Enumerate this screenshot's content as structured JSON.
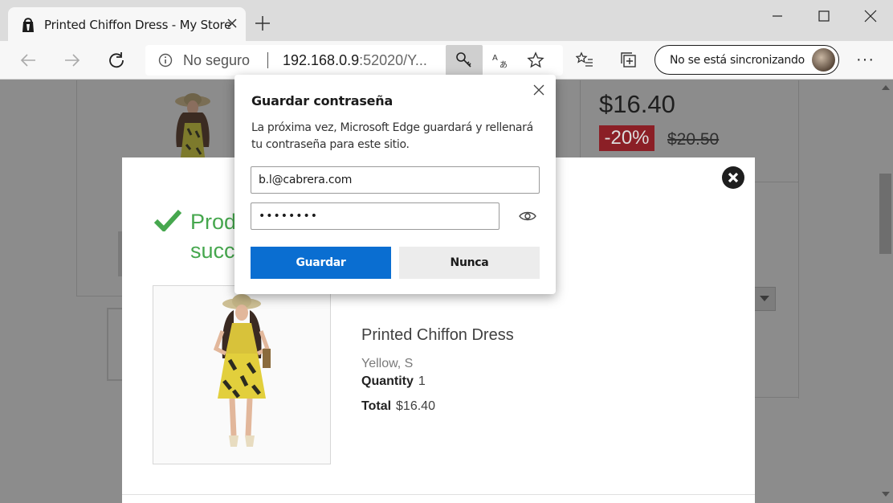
{
  "browser": {
    "tab_title": "Printed Chiffon Dress - My Store",
    "not_secure_label": "No seguro",
    "url_host": "192.168.0.9",
    "url_rest": ":52020/Y...",
    "sync_label": "No se está sincronizando",
    "more_label": "···"
  },
  "page": {
    "price": "$16.40",
    "discount": "-20%",
    "old_price": "$20.50"
  },
  "cart_modal": {
    "success_text": "Product successfully added to your shopping cart",
    "product_name": "Printed Chiffon Dress",
    "product_attributes": "Yellow, S",
    "quantity_label": "Quantity",
    "quantity_value": "1",
    "total_label": "Total",
    "total_value": "$16.40"
  },
  "password_popup": {
    "title": "Guardar contraseña",
    "description": "La próxima vez, Microsoft Edge guardará y rellenará tu contraseña para este sitio.",
    "username": "b.l@cabrera.com",
    "password_mask": "••••••••",
    "save_label": "Guardar",
    "never_label": "Nunca"
  },
  "colors": {
    "accent_blue": "#0a6ed1",
    "success_green": "#46a74e",
    "discount_red": "#d0313c"
  }
}
